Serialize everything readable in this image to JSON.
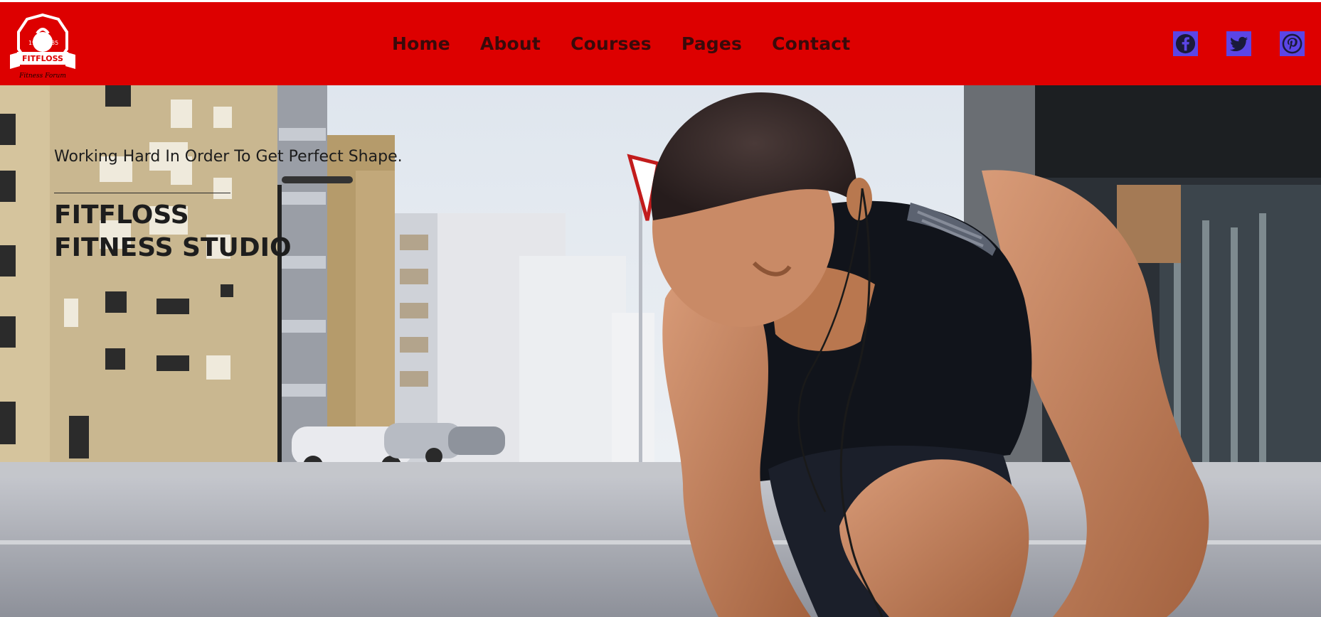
{
  "brand": {
    "name": "FITFLOSS",
    "tagline": "Fitness Forum",
    "year_left": "19",
    "year_right": "85"
  },
  "nav": {
    "items": [
      {
        "label": "Home"
      },
      {
        "label": "About"
      },
      {
        "label": "Courses"
      },
      {
        "label": "Pages"
      },
      {
        "label": "Contact"
      }
    ]
  },
  "social": {
    "icons": [
      "facebook-icon",
      "twitter-icon",
      "pinterest-icon"
    ]
  },
  "hero": {
    "tagline": "Working Hard In Order To Get Perfect Shape.",
    "title_line1": "FITFLOSS",
    "title_line2": "FITNESS STUDIO"
  },
  "colors": {
    "header_bg": "#dd0000",
    "nav_text": "#3a0a0a",
    "social_icon_bg": "#5b45e6",
    "hero_text": "#1d1d1d"
  }
}
